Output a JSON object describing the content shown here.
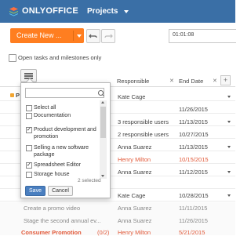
{
  "app": {
    "logo": "ONLYOFFICE",
    "module": "Projects"
  },
  "toolbar": {
    "create_label": "Create New ...",
    "timer": "01:01:08"
  },
  "filter": {
    "open_only_label": "Open tasks and milestones only"
  },
  "table": {
    "columns": [
      "Responsible",
      "End Date"
    ],
    "rows": [
      {
        "title": "",
        "count": "",
        "responsible": "Kate Cage",
        "date": "",
        "overdue": false
      },
      {
        "title": "",
        "count": "",
        "responsible": "",
        "date": "11/26/2015",
        "overdue": false
      },
      {
        "title": "",
        "count": "",
        "responsible": "3 responsible users",
        "date": "11/13/2015",
        "overdue": false
      },
      {
        "title": "",
        "count": "",
        "responsible": "2 responsible users",
        "date": "10/27/2015",
        "overdue": false
      },
      {
        "title": "",
        "count": "",
        "responsible": "",
        "date": "",
        "overdue": false
      },
      {
        "title": "",
        "count": "",
        "responsible": "Anna Suarez",
        "date": "11/13/2015",
        "overdue": false
      },
      {
        "title": "",
        "count": "",
        "responsible": "Henry Milton",
        "date": "10/15/2015",
        "overdue": true
      },
      {
        "title": "",
        "count": "",
        "responsible": "Anna Suarez",
        "date": "11/12/2015",
        "overdue": false
      },
      {
        "title": "",
        "count": "",
        "responsible": "",
        "date": "",
        "overdue": false
      },
      {
        "title": "",
        "count": "",
        "responsible": "Kate Cage",
        "date": "10/28/2015",
        "overdue": false
      },
      {
        "title": "Create a promo video",
        "count": "",
        "responsible": "Anna Suarez",
        "date": "11/11/2015",
        "overdue": false
      },
      {
        "title": "Stage the second annual ev...",
        "count": "",
        "responsible": "Anna Suarez",
        "date": "11/26/2015",
        "overdue": false
      }
    ],
    "milestone": {
      "title": "Consumer Promotion",
      "count": "(0/2)",
      "responsible": "Henry Milton",
      "date": "5/21/2015"
    }
  },
  "popup": {
    "search_placeholder": "",
    "items": [
      {
        "label": "Select all",
        "checked": false
      },
      {
        "label": "Documentation",
        "checked": false
      },
      {
        "label": "Product development and promotion",
        "checked": true
      },
      {
        "label": "Selling a new software package",
        "checked": false
      },
      {
        "label": "Spreadsheet Editor",
        "checked": true
      },
      {
        "label": "Storage house",
        "checked": false
      }
    ],
    "selected_count": "2 selected",
    "save_label": "Save",
    "cancel_label": "Cancel"
  },
  "colors": {
    "header": "#3a6fa6",
    "accent": "#ff7e20",
    "overdue": "#e25a3a",
    "save": "#4a7fc0"
  }
}
